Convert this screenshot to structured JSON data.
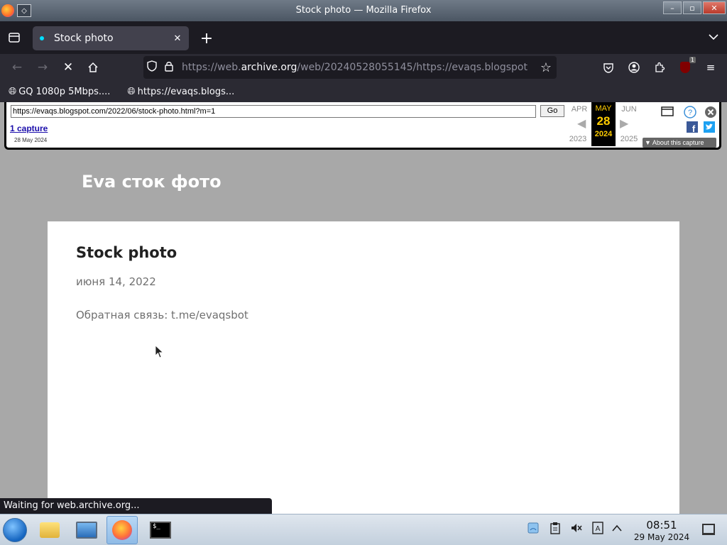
{
  "window": {
    "title": "Stock photo — Mozilla Firefox",
    "controls": {
      "minimize": "–",
      "maximize": "▫",
      "close": "✕"
    }
  },
  "tabs": [
    {
      "title": "Stock photo",
      "close": "✕"
    }
  ],
  "newtab_label": "+",
  "nav": {
    "url_host_prefix": "https://web.",
    "url_host": "archive.org",
    "url_rest": "/web/20240528055145/https://evaqs.blogspot"
  },
  "bookmarks": [
    {
      "label": "GQ 1080p 5Mbps...."
    },
    {
      "label": "https://evaqs.blogs..."
    }
  ],
  "wayback": {
    "url": "https://evaqs.blogspot.com/2022/06/stock-photo.html?m=1",
    "go": "Go",
    "captures": "1 capture",
    "capture_date": "28 May 2024",
    "prev_month": "APR",
    "cur_month": "MAY",
    "next_month": "JUN",
    "day": "28",
    "prev_year": "2023",
    "cur_year": "2024",
    "next_year": "2025",
    "about": "About this capture"
  },
  "page": {
    "blog_title": "Eva сток фото",
    "post_title": "Stock photo",
    "post_date": "июня 14, 2022",
    "post_body": "Обратная связь: t.me/evaqsbot"
  },
  "status": "Waiting for web.archive.org...",
  "clock": {
    "time": "08:51",
    "date": "29 May 2024"
  },
  "colors": {
    "wayback_highlight": "#ffcc00",
    "page_bg": "#a8a8a8"
  }
}
